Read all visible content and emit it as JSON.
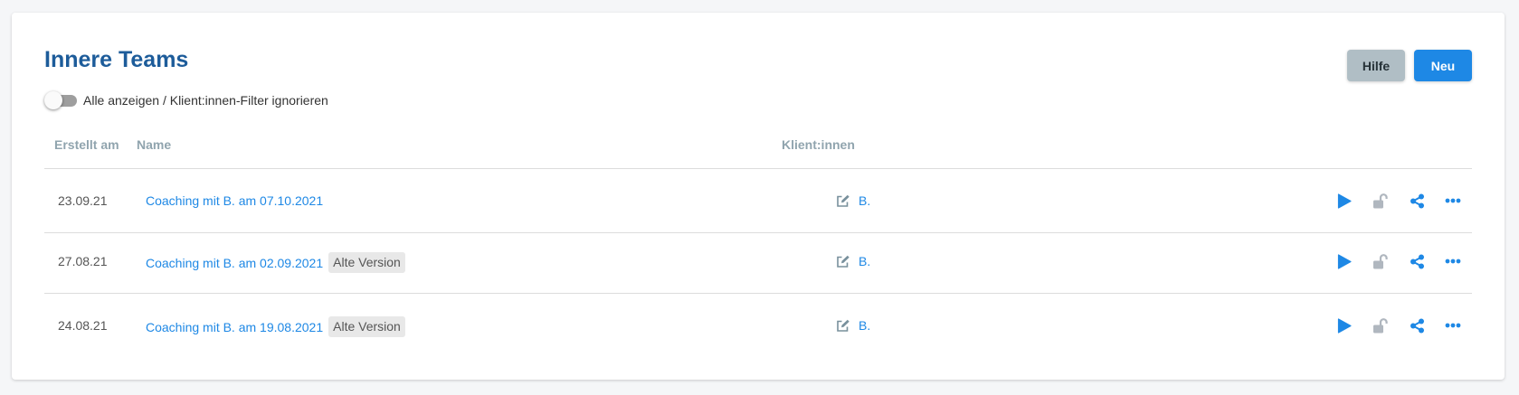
{
  "page": {
    "title": "Innere Teams"
  },
  "filter": {
    "toggle_label": "Alle anzeigen / Klient:innen-Filter ignorieren",
    "enabled": false
  },
  "buttons": {
    "help": "Hilfe",
    "new": "Neu"
  },
  "table": {
    "headers": {
      "created": "Erstellt am",
      "name": "Name",
      "clients": "Klient:innen"
    },
    "rows": [
      {
        "created": "23.09.21",
        "name": "Coaching mit B. am 07.10.2021",
        "badge": "",
        "client": "B."
      },
      {
        "created": "27.08.21",
        "name": "Coaching mit B. am 02.09.2021",
        "badge": "Alte Version",
        "client": "B."
      },
      {
        "created": "24.08.21",
        "name": "Coaching mit B. am 19.08.2021",
        "badge": "Alte Version",
        "client": "B."
      }
    ]
  },
  "icons": {
    "client_edit": "edit-icon",
    "actions": [
      "play-icon",
      "unlock-icon",
      "share-icon",
      "more-icon"
    ]
  },
  "colors": {
    "title": "#1d5c9a",
    "accent": "#1e88e5",
    "help_button": "#b0bec5",
    "lock_icon": "#b0b7bf",
    "header_text": "#90a4ae"
  }
}
